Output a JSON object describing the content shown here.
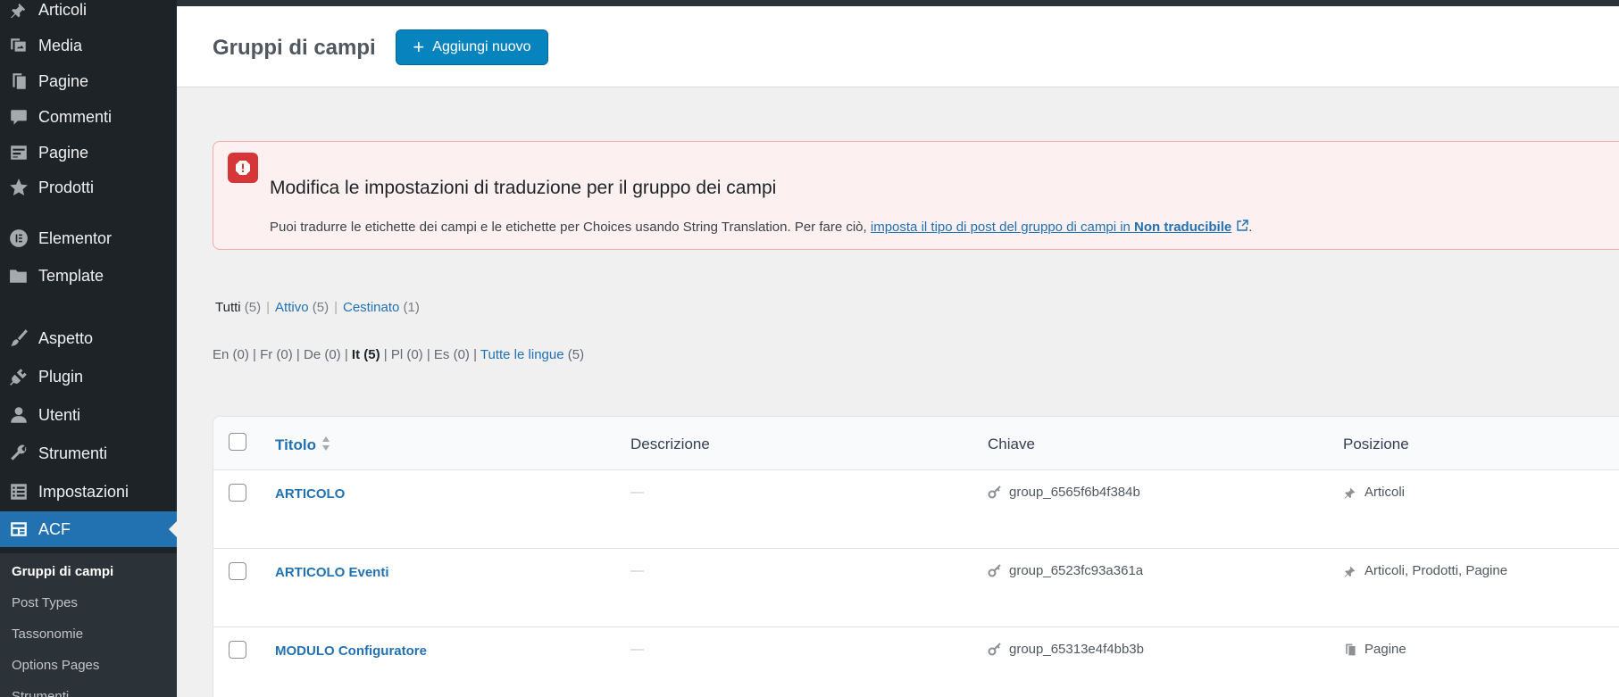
{
  "sidebar": {
    "items": [
      {
        "label": "Articoli",
        "icon": "pin-icon"
      },
      {
        "label": "Media",
        "icon": "media-icon"
      },
      {
        "label": "Pagine",
        "icon": "page-icon"
      },
      {
        "label": "Commenti",
        "icon": "comment-icon"
      },
      {
        "label": "Pagine",
        "icon": "forms-icon"
      },
      {
        "label": "Prodotti",
        "icon": "star-icon"
      },
      {
        "label": "Elementor",
        "icon": "elementor-icon"
      },
      {
        "label": "Template",
        "icon": "folder-icon"
      },
      {
        "label": "Aspetto",
        "icon": "brush-icon"
      },
      {
        "label": "Plugin",
        "icon": "plugin-icon"
      },
      {
        "label": "Utenti",
        "icon": "user-icon"
      },
      {
        "label": "Strumenti",
        "icon": "wrench-icon"
      },
      {
        "label": "Impostazioni",
        "icon": "settings-icon"
      },
      {
        "label": "ACF",
        "icon": "acf-icon"
      }
    ],
    "submenu": [
      "Gruppi di campi",
      "Post Types",
      "Tassonomie",
      "Options Pages",
      "Strumenti"
    ]
  },
  "header": {
    "title": "Gruppi di campi",
    "add_button": "Aggiungi nuovo"
  },
  "notice": {
    "title": "Modifica le impostazioni di traduzione per il gruppo dei campi",
    "text": "Puoi tradurre le etichette dei campi e le etichette per Choices usando String Translation. Per fare ciò, ",
    "link_text": "imposta il tipo di post del gruppo di campi in ",
    "link_bold": "Non traducibile",
    "link_end": "."
  },
  "status_filters": {
    "all_label": "Tutti",
    "all_count": "(5)",
    "active_label": "Attivo",
    "active_count": "(5)",
    "trash_label": "Cestinato",
    "trash_count": "(1)"
  },
  "lang_filters": {
    "en": "En (0)",
    "fr": "Fr (0)",
    "de": "De (0)",
    "it": "It (5)",
    "pl": "Pl (0)",
    "es": "Es (0)",
    "all_label": "Tutte le lingue",
    "all_count": "(5)"
  },
  "table": {
    "headers": {
      "title": "Titolo",
      "description": "Descrizione",
      "key": "Chiave",
      "position": "Posizione"
    },
    "rows": [
      {
        "title": "ARTICOLO",
        "description": "—",
        "key": "group_6565f6b4f384b",
        "position": "Articoli",
        "position_icon": "pin-icon"
      },
      {
        "title": "ARTICOLO Eventi",
        "description": "—",
        "key": "group_6523fc93a361a",
        "position": "Articoli, Prodotti, Pagine",
        "position_icon": "pin-icon"
      },
      {
        "title": "MODULO Configuratore",
        "description": "—",
        "key": "group_65313e4f4bb3b",
        "position": "Pagine",
        "position_icon": "page-icon"
      }
    ]
  },
  "colors": {
    "sidebar_bg": "#1d2327",
    "accent": "#2271b1",
    "button": "#0783be",
    "notice_bg": "#fcf0f1",
    "error": "#d63638"
  }
}
